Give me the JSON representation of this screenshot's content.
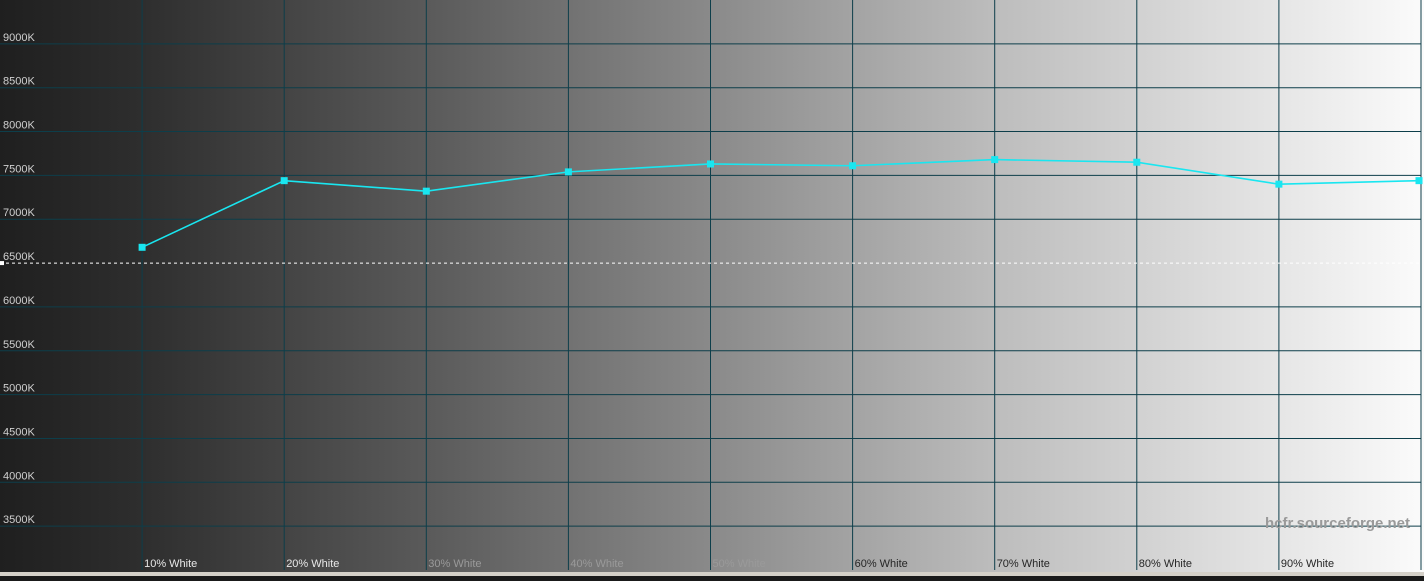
{
  "watermark": "hcfr.sourceforge.net",
  "colors": {
    "series": "#19e6f0",
    "grid": "#0d3e4a",
    "reference": "#ffffff"
  },
  "chart_data": {
    "type": "line",
    "title": "",
    "xlabel": "",
    "ylabel": "",
    "categories": [
      "",
      "10% White",
      "20% White",
      "30% White",
      "40% White",
      "50% White",
      "60% White",
      "70% White",
      "80% White",
      "90% White",
      ""
    ],
    "ylim": [
      3000,
      9500
    ],
    "yticks": [
      "9000K",
      "8500K",
      "8000K",
      "7500K",
      "7000K",
      "6500K",
      "6000K",
      "5500K",
      "5000K",
      "4500K",
      "4000K",
      "3500K"
    ],
    "ytick_values": [
      9000,
      8500,
      8000,
      7500,
      7000,
      6500,
      6000,
      5500,
      5000,
      4500,
      4000,
      3500
    ],
    "reference_value": 6500,
    "series": [
      {
        "values": [
          null,
          6680,
          7440,
          7320,
          7540,
          7630,
          7610,
          7680,
          7650,
          7400,
          7440
        ]
      }
    ],
    "grid": true,
    "legend": "none"
  }
}
